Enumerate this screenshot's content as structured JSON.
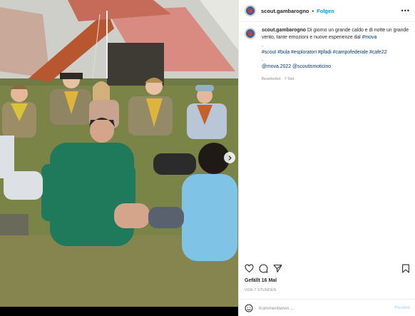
{
  "header": {
    "username": "scout.gambarogno",
    "separator": "•",
    "follow_label": "Folgen",
    "more_label": "•••"
  },
  "caption": {
    "username": "scout.gambarogno",
    "text": "Di giorno un grande caldo e di notte un grande vento, tante emozioni e nuove esperienze dal",
    "first_tag": "#mova",
    "dot1": ".",
    "tags": [
      "#scout",
      "#bula",
      "#esploratori",
      "#pfadi",
      "#campofederale",
      "#cafe22"
    ],
    "dot2": ".",
    "mentions": [
      "@mova.2022",
      "@scoutismoticino"
    ],
    "edited": "Bearbeitet · 7 Std."
  },
  "icons": {
    "like": "heart-icon",
    "comment": "comment-icon",
    "share": "share-icon",
    "save": "bookmark-icon",
    "next": "chevron-right-icon",
    "emoji": "smiley-icon"
  },
  "stats": {
    "likes": "Gefällt 16 Mal",
    "time": "VOR 7 STUNDEN"
  },
  "comment": {
    "placeholder": "Kommentieren ...",
    "post_label": "Posten"
  },
  "colors": {
    "link": "#0095f6",
    "hashtag": "#00376b",
    "post_disabled": "#b3dbff"
  }
}
